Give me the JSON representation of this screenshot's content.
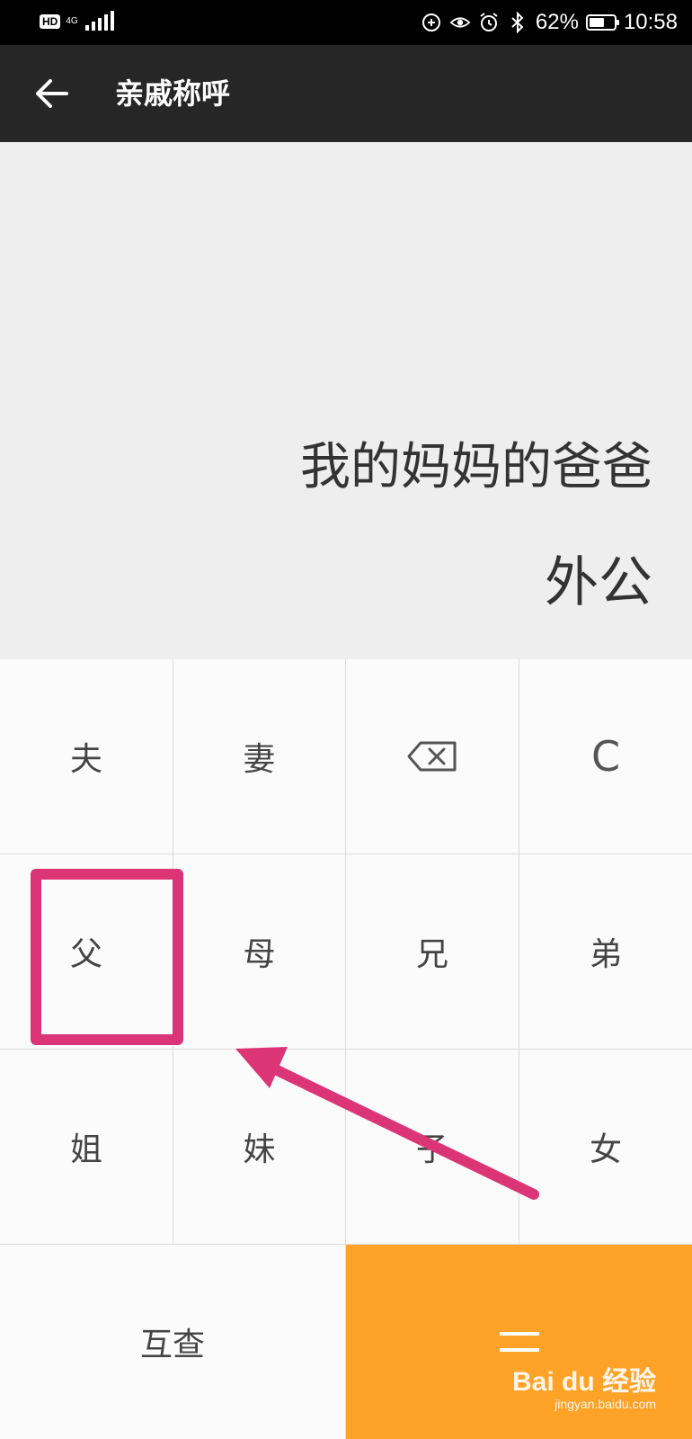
{
  "status_bar": {
    "hd": "HD",
    "network": "4G",
    "battery_percent": "62%",
    "battery_level": 0.62,
    "time": "10:58"
  },
  "app_bar": {
    "title": "亲戚称呼"
  },
  "display": {
    "expression": "我的妈妈的爸爸",
    "result": "外公"
  },
  "keypad": {
    "row1": [
      "夫",
      "妻",
      "backspace-icon",
      "C"
    ],
    "row2": [
      "父",
      "母",
      "兄",
      "弟"
    ],
    "row3": [
      "姐",
      "妹",
      "子",
      "女"
    ],
    "mutual_check": "互查",
    "equals_icon": "equals-icon"
  },
  "colors": {
    "appbar_bg": "#262626",
    "display_bg": "#eeeeee",
    "accent_orange": "#ffa228",
    "annotation_pink": "#db3577"
  },
  "watermark": {
    "logo": "Bai du 经验",
    "url": "jingyan.baidu.com"
  }
}
